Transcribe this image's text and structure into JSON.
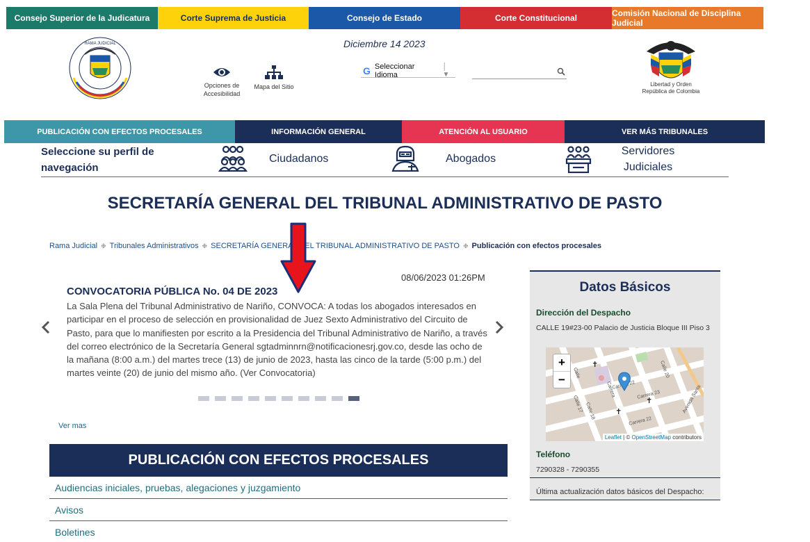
{
  "topbar": {
    "items": [
      {
        "label": "Consejo Superior de la Judicatura"
      },
      {
        "label": "Corte Suprema de Justicia"
      },
      {
        "label": "Consejo de Estado"
      },
      {
        "label": "Corte Constitucional"
      },
      {
        "label": "Comisión Nacional de Disciplina Judicial"
      }
    ]
  },
  "header": {
    "logo_rama_text": "RAMA JUDICIAL · REPÚBLICA DE COLOMBIA",
    "accessibility_label_1": "Opciones de",
    "accessibility_label_2": "Accesibilidad",
    "sitemap_label": "Mapa del Sitio",
    "date": "Diciembre 14 2023",
    "language_label": "Seleccionar Idioma",
    "search_placeholder": "",
    "coat_of_arms_text_1": "Libertad y Orden",
    "coat_of_arms_text_2": "República de Colombia"
  },
  "main_nav": {
    "items": [
      {
        "label": "PUBLICACIÓN CON EFECTOS PROCESALES"
      },
      {
        "label": "INFORMACIÓN GENERAL"
      },
      {
        "label": "ATENCIÓN AL USUARIO"
      },
      {
        "label": "VER MÁS TRIBUNALES"
      }
    ]
  },
  "profile": {
    "title": "Seleccione su perfil de navegación",
    "items": [
      {
        "label": "Ciudadanos"
      },
      {
        "label": "Abogados"
      },
      {
        "label": "Servidores Judiciales"
      }
    ]
  },
  "page_title": "SECRETARÍA GENERAL DEL TRIBUNAL ADMINISTRATIVO DE PASTO",
  "breadcrumb": {
    "items": [
      {
        "label": "Rama Judicial"
      },
      {
        "label": "Tribunales Administrativos"
      },
      {
        "label": "SECRETARÍA GENERAL DEL TRIBUNAL ADMINISTRATIVO DE PASTO"
      }
    ],
    "current": "Publicación con efectos procesales"
  },
  "carousel": {
    "date": "08/06/2023 01:26PM",
    "title": "CONVOCATORIA PÚBLICA No. 04 DE 2023",
    "body": "La Sala Plena del Tribunal Administrativo de Nariño, CONVOCA: A todas los abogados interesados en participar en el proceso de selección en provisionalidad de Juez Sexto Administrativo del Circuito de Pasto, para que lo manifiesten por escrito a la Presidencia del Tribunal Administrativo de Nariño, a través del correo electrónico de la Secretaría General sgtadminnrn@notificacionesrj.gov.co, desde las ocho de la mañana (8:00 a.m.) del martes trece (13) de junio de 2023, hasta las cinco de la tarde (5:00 p.m.) del martes veinte (20) de junio del mismo año. (Ver Convocatoria)",
    "slide_count": 10,
    "active_slide": 10,
    "ver_mas": "Ver mas"
  },
  "publicacion": {
    "title": "PUBLICACIÓN CON EFECTOS PROCESALES",
    "items": [
      {
        "label": "Audiencias iniciales, pruebas, alegaciones y juzgamiento"
      },
      {
        "label": "Avisos"
      },
      {
        "label": "Boletines"
      }
    ]
  },
  "datos_basicos": {
    "title": "Datos Básicos",
    "direccion_label": "Dirección del Despacho",
    "direccion": "CALLE 19#23-00 Palacio de Justicia Bloque III Piso 3",
    "map": {
      "zoom_in": "+",
      "zoom_out": "−",
      "attribution_leaflet": "Leaflet",
      "attribution_osm": "OpenStreetMap",
      "attribution_rest": "contributors",
      "street_labels": [
        "Calle",
        "Carrera 22",
        "Carrera 23",
        "Calle 18",
        "Calle 17",
        "Carrera",
        "Calle 20",
        "Avenida Santa"
      ]
    },
    "telefono_label": "Teléfono",
    "telefono": "7290328 - 7290355",
    "actualizacion": "Última actualización datos básicos del Despacho:"
  }
}
